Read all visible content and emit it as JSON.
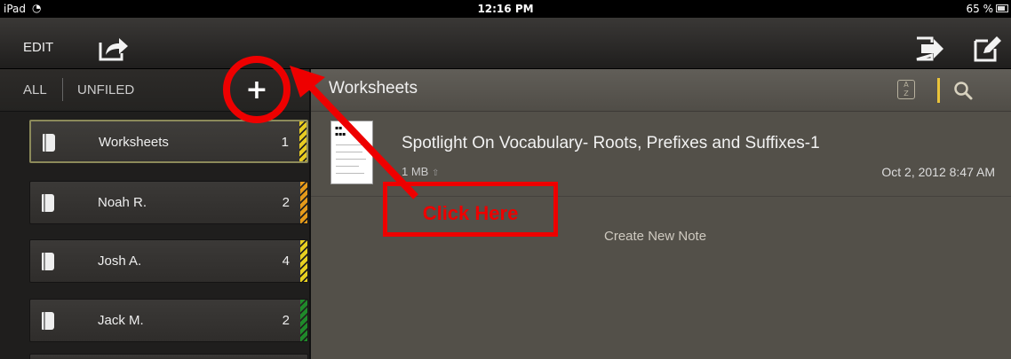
{
  "status_bar": {
    "carrier": "iPad",
    "time": "12:16 PM",
    "battery": "65 %"
  },
  "toolbar": {
    "edit_label": "EDIT",
    "share_icon": "share-icon",
    "move_icon": "move-to-icon",
    "compose_icon": "compose-icon"
  },
  "sidebar": {
    "filters": {
      "all_label": "ALL",
      "unfiled_label": "UNFILED",
      "add_label": "+"
    },
    "notebooks": [
      {
        "name": "Worksheets",
        "count": "1",
        "tab_color": "#e8cc22",
        "selected": true
      },
      {
        "name": "Noah R.",
        "count": "2",
        "tab_color": "#e59a1a",
        "selected": false
      },
      {
        "name": "Josh A.",
        "count": "4",
        "tab_color": "#e8d020",
        "selected": false
      },
      {
        "name": "Jack M.",
        "count": "2",
        "tab_color": "#1f8a2a",
        "selected": false
      }
    ]
  },
  "main": {
    "title": "Worksheets",
    "sort_icon": "sort-az-icon",
    "search_icon": "search-icon",
    "notes": [
      {
        "title": "Spotlight On Vocabulary- Roots, Prefixes and Suffixes-1",
        "size": "1 MB",
        "date": "Oct 2, 2012 8:47 AM"
      }
    ],
    "create_label": "Create New Note"
  },
  "annotation": {
    "callout_label": "Click Here",
    "color": "#e00000"
  }
}
